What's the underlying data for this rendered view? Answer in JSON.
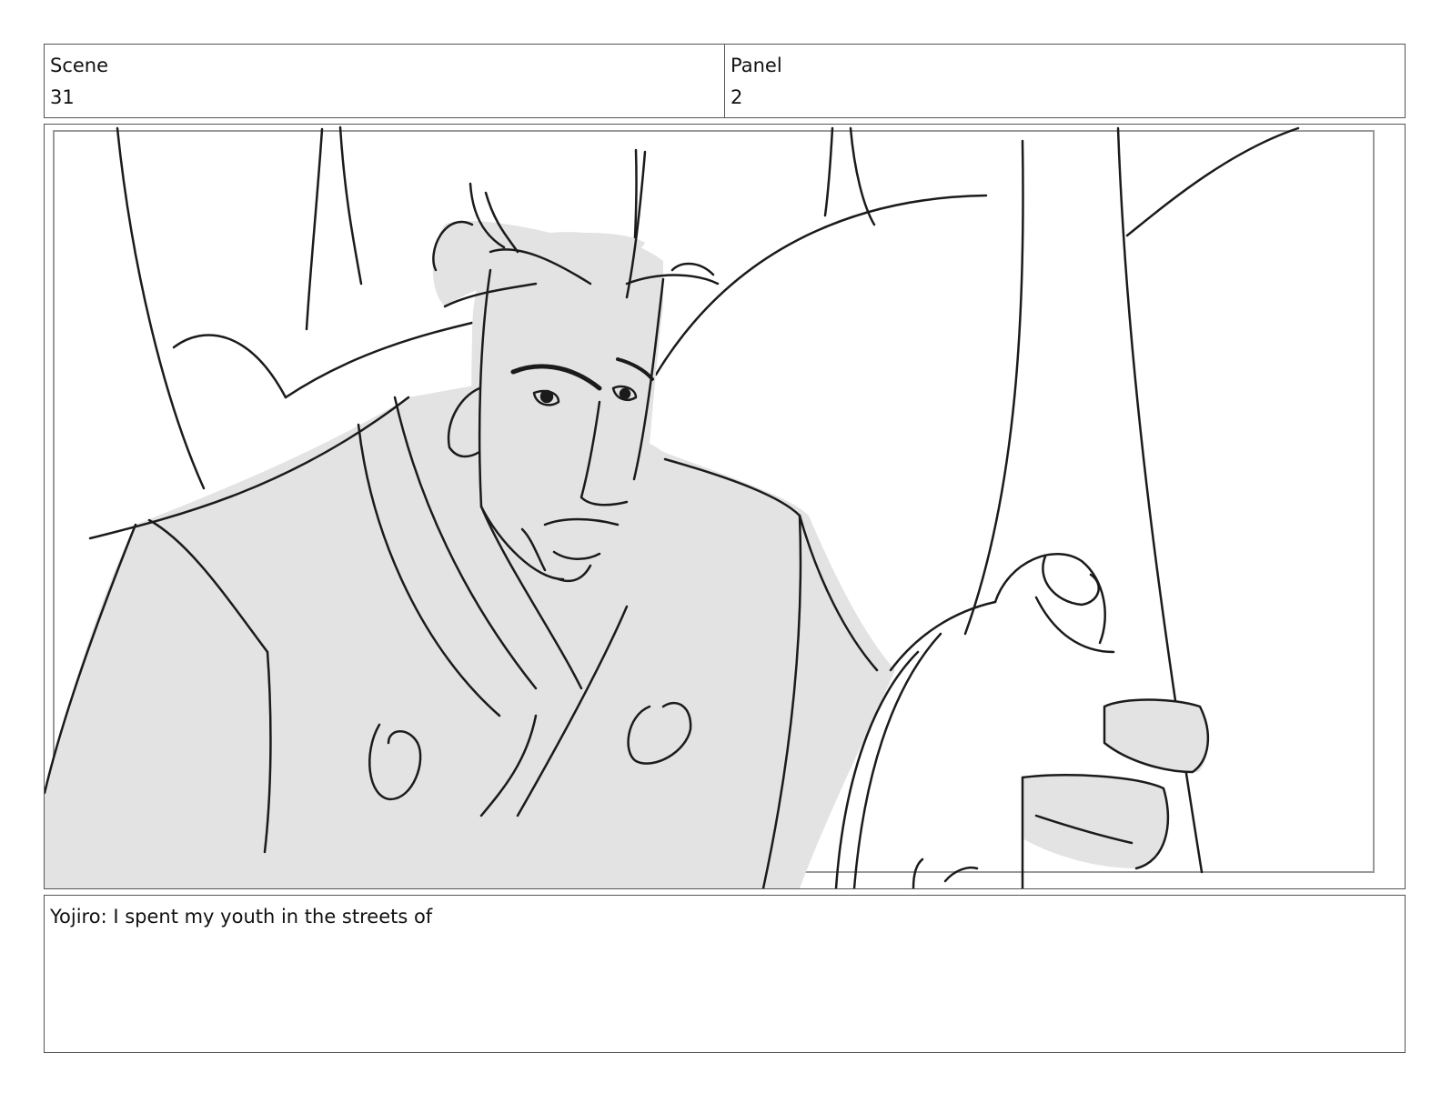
{
  "header": {
    "scene_label": "Scene",
    "scene_value": "31",
    "panel_label": "Panel",
    "panel_value": "2"
  },
  "panel_image": {
    "icon": "storyboard-sketch"
  },
  "caption": {
    "text": "Yojiro: I spent my youth in the streets of"
  }
}
